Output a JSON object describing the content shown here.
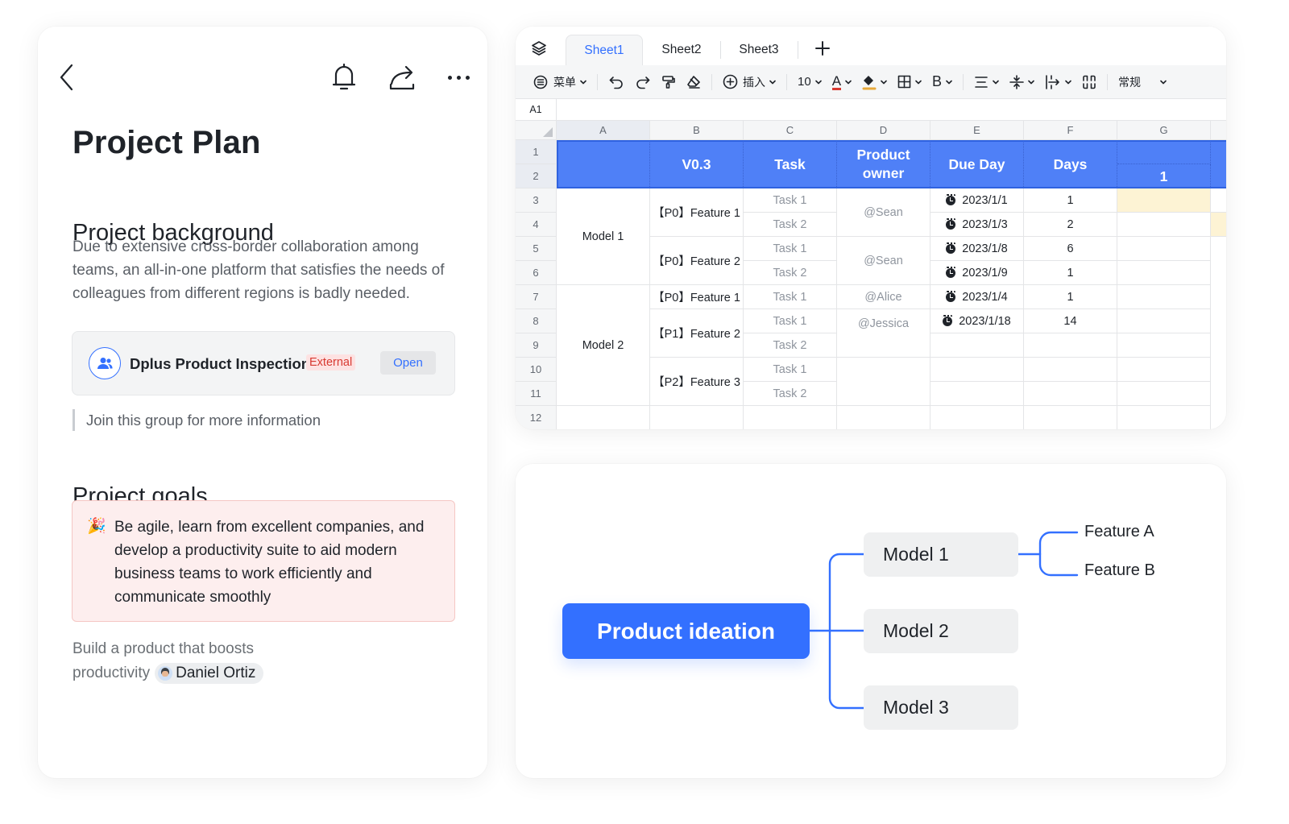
{
  "doc": {
    "title": "Project Plan",
    "icons": {
      "back": "chevron-left-icon",
      "bell": "bell-icon",
      "share": "share-icon",
      "more": "more-icon"
    },
    "background": {
      "heading": "Project background",
      "text": "Due to extensive cross-border collaboration among teams, an all-in-one platform that satisfies the needs of colleagues from different regions is badly needed."
    },
    "group_card": {
      "icon": "group-icon",
      "name": "Dplus Product Inspection",
      "badge": "External",
      "button": "Open"
    },
    "quote": "Join this group for more information",
    "goals": {
      "heading": "Project goals",
      "callout_emoji": "🎉",
      "callout_text": "Be agile, learn from excellent companies, and develop a productivity suite to aid modern business teams to work efficiently and communicate smoothly",
      "item_text": "Build a product that boosts productivity",
      "mention": "Daniel Ortiz"
    }
  },
  "sheet": {
    "tabs": [
      {
        "label": "Sheet1",
        "active": true
      },
      {
        "label": "Sheet2",
        "active": false
      },
      {
        "label": "Sheet3",
        "active": false
      }
    ],
    "add_tab_icon": "plus-icon",
    "toolbar": {
      "menu": "菜单",
      "insert": "插入",
      "font_size": "10",
      "bold": "B",
      "font_color_letter": "A",
      "number_format": "常规"
    },
    "cell_ref": "A1",
    "columns": [
      "A",
      "B",
      "C",
      "D",
      "E",
      "F",
      "G"
    ],
    "rows": [
      "1",
      "2",
      "3",
      "4",
      "5",
      "6",
      "7",
      "8",
      "9",
      "10",
      "11",
      "12"
    ],
    "header": {
      "version": "V0.3",
      "task": "Task",
      "owner": "Product owner",
      "due": "Due Day",
      "days": "Days",
      "g_value": "1"
    },
    "models": [
      "Model 1",
      "Model 2"
    ],
    "features": [
      "【P0】Feature 1",
      "【P0】Feature 2",
      "【P0】Feature 1",
      "【P1】Feature 2",
      "【P2】Feature 3"
    ],
    "tasks": [
      "Task 1",
      "Task 2",
      "Task 1",
      "Task 2",
      "Task 1",
      "Task 1",
      "Task 2",
      "Task 1",
      "Task 2"
    ],
    "owners": [
      "@Sean",
      "@Sean",
      "@Alice",
      "@Jessica"
    ],
    "due_dates": [
      "2023/1/1",
      "2023/1/3",
      "2023/1/8",
      "2023/1/9",
      "2023/1/4",
      "2023/1/18"
    ],
    "days": [
      "1",
      "2",
      "6",
      "1",
      "1",
      "14"
    ]
  },
  "mindmap": {
    "root": "Product ideation",
    "children": [
      "Model 1",
      "Model 2",
      "Model 3"
    ],
    "model1_leaves": [
      "Feature A",
      "Feature B"
    ],
    "line_color": "#3370ff"
  },
  "colors": {
    "accent": "#3370ff",
    "sheet_header": "#4f80f7",
    "badge_red": "#d83931",
    "callout_bg": "#fdeeee",
    "highlight_yellow": "#fdf3d4"
  }
}
